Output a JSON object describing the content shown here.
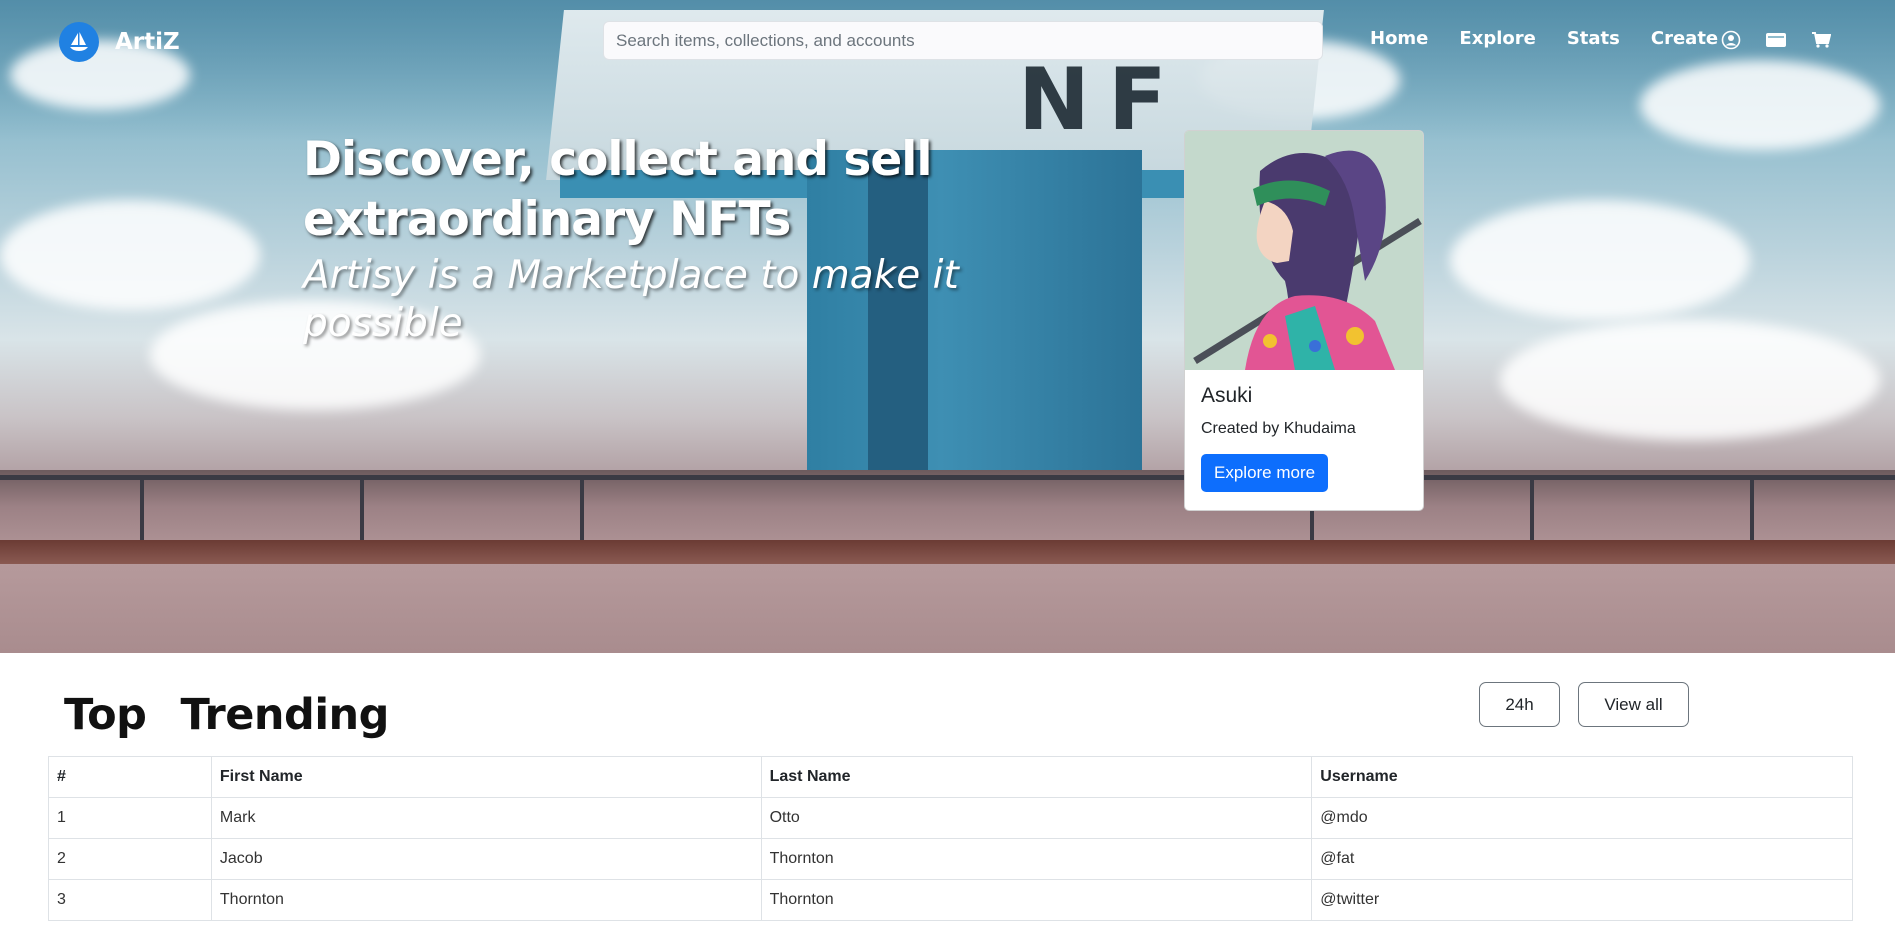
{
  "nav": {
    "brand": "ArtiZ",
    "search_placeholder": "Search items, collections, and accounts",
    "links": [
      "Home",
      "Explore",
      "Stats",
      "Create"
    ],
    "icons": [
      "account-circle-icon",
      "wallet-icon",
      "cart-icon"
    ]
  },
  "hero": {
    "title": "Discover, collect and sell extraordinary NFTs",
    "subtitle": "Artisy is a Marketplace to make it possible"
  },
  "card": {
    "title": "Asuki",
    "creator": "Created by Khudaima",
    "button": "Explore more"
  },
  "trending": {
    "title_word1": "Top",
    "title_word2": "Trending",
    "filter_button": "24h",
    "view_all_button": "View all",
    "columns": [
      "#",
      "First Name",
      "Last Name",
      "Username"
    ],
    "rows": [
      [
        "1",
        "Mark",
        "Otto",
        "@mdo"
      ],
      [
        "2",
        "Jacob",
        "Thornton",
        "@fat"
      ],
      [
        "3",
        "Thornton",
        "Thornton",
        "@twitter"
      ]
    ]
  },
  "colors": {
    "primary": "#0d6efd",
    "brand_logo": "#2081e2",
    "card_bg": "#c4d9cc"
  }
}
